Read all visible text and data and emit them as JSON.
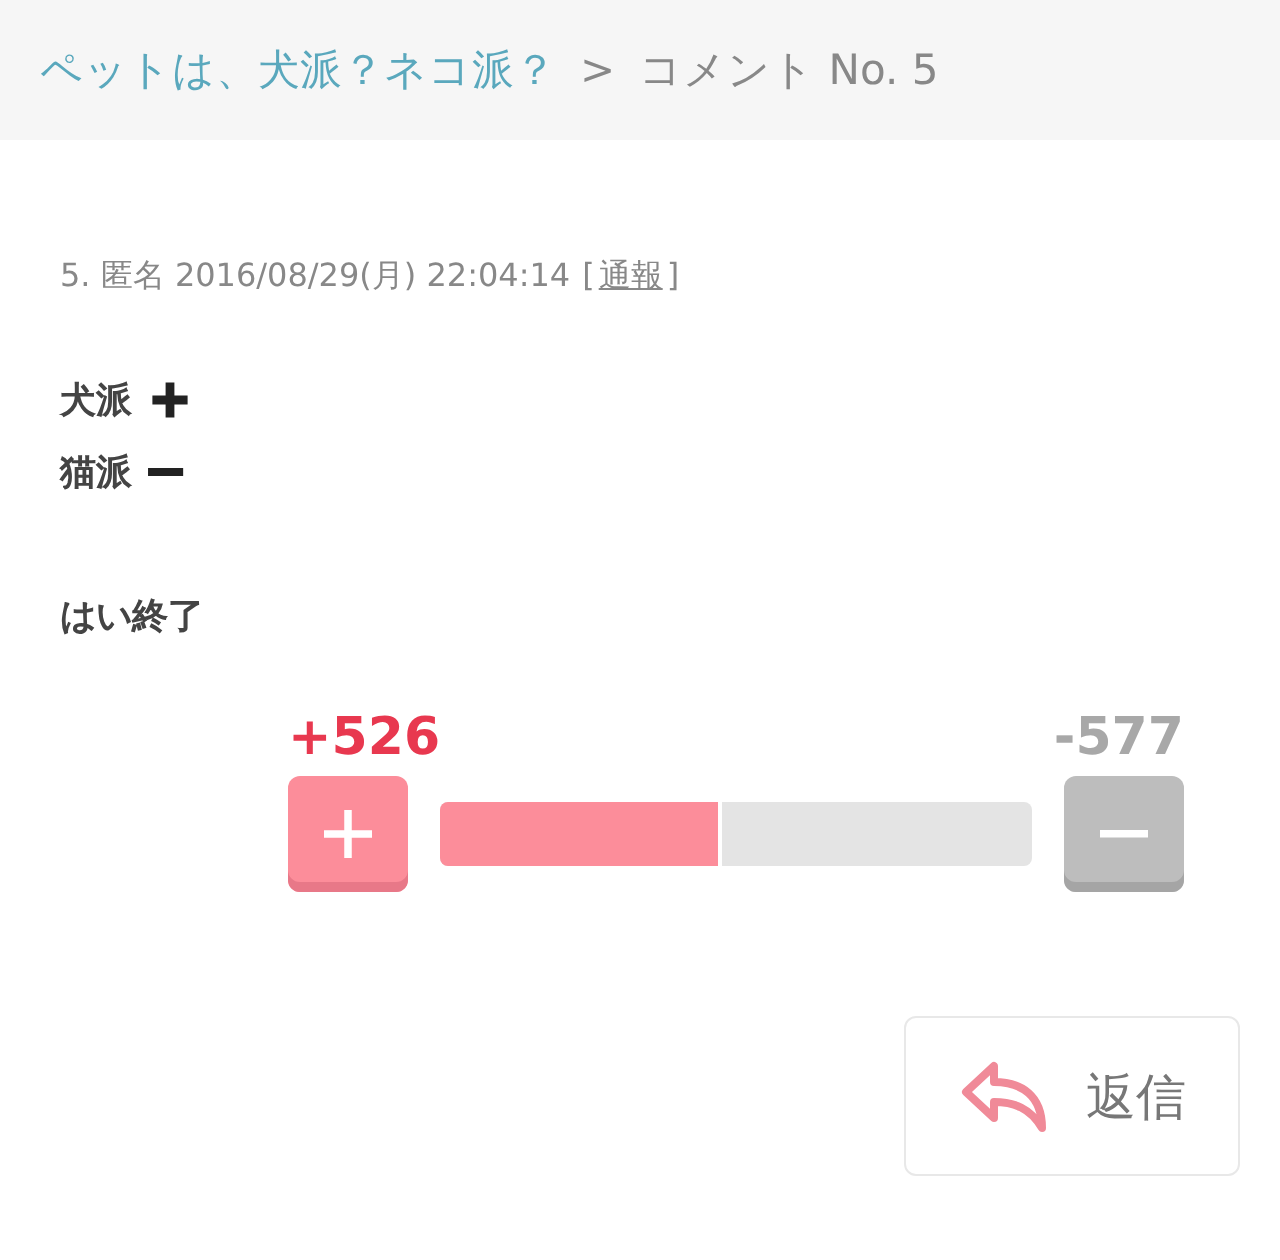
{
  "breadcrumb": {
    "parent": "ペットは、犬派？ネコ派？",
    "separator": ">",
    "current": "コメント No. 5"
  },
  "comment": {
    "meta": "5. 匿名 2016/08/29(月) 22:04:14",
    "report_open": "[",
    "report": "通報",
    "report_close": "]",
    "lines": [
      {
        "kind": "plus",
        "text": "犬派"
      },
      {
        "kind": "minus",
        "text": "猫派"
      },
      {
        "kind": "gap"
      },
      {
        "kind": "text",
        "text": "はい終了"
      }
    ]
  },
  "vote": {
    "plus": "+526",
    "minus": "-577",
    "level": 0.47
  },
  "reply": {
    "label": "返信"
  }
}
